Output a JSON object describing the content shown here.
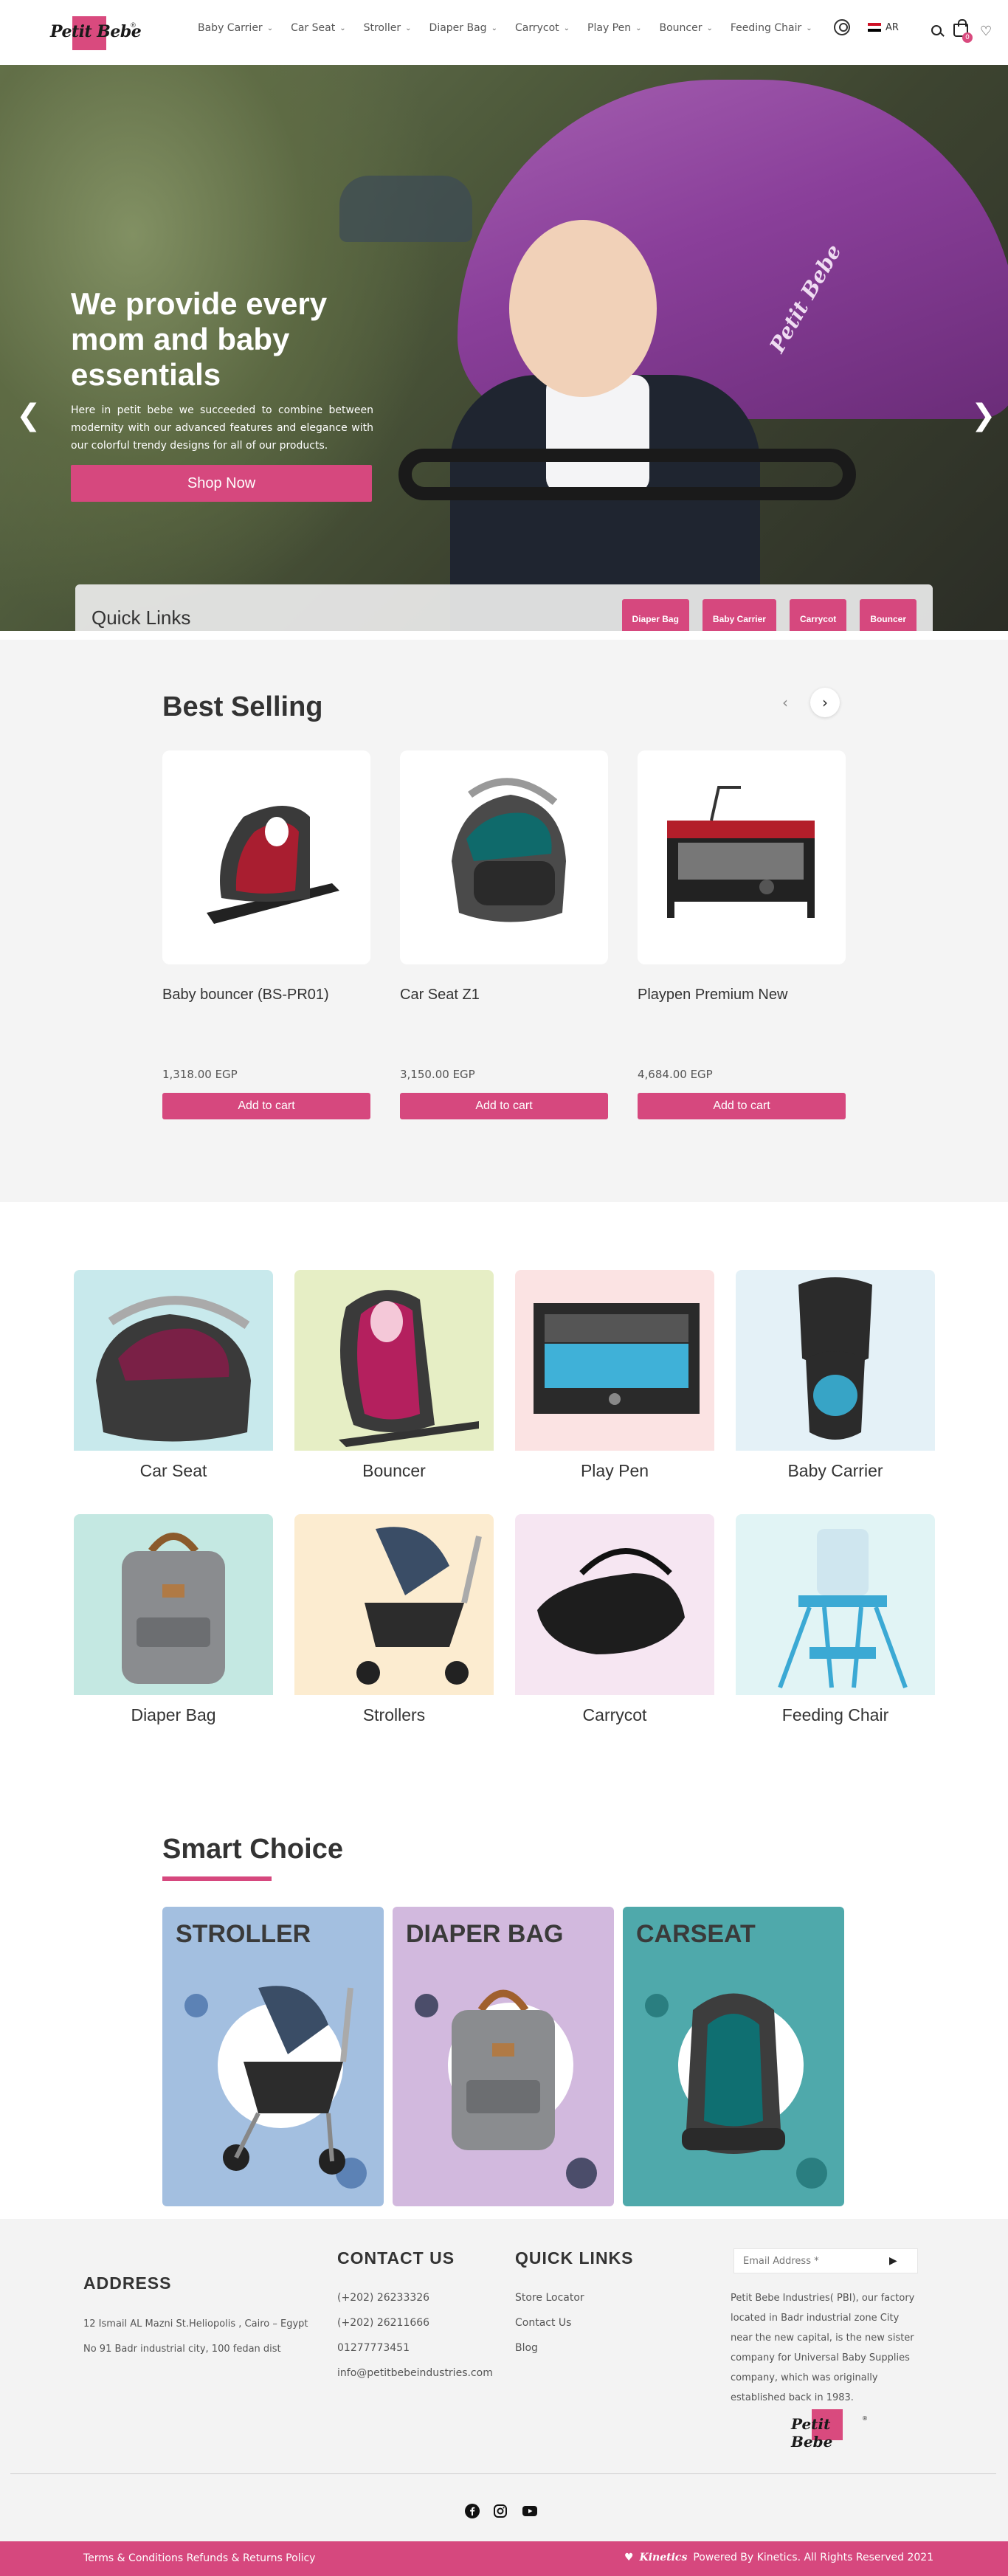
{
  "brand": {
    "logo_text": "Petit Bebe",
    "reg_mark": "®"
  },
  "header": {
    "nav": [
      {
        "label": "Baby Carrier"
      },
      {
        "label": "Car Seat"
      },
      {
        "label": "Stroller"
      },
      {
        "label": "Diaper Bag"
      },
      {
        "label": "Carrycot"
      },
      {
        "label": "Play Pen"
      },
      {
        "label": "Bouncer"
      },
      {
        "label": "Feeding Chair"
      }
    ],
    "lang_label": "AR",
    "cart_count": "0",
    "icons": [
      "user-icon",
      "flag-icon",
      "search-icon",
      "bag-icon",
      "heart-icon"
    ]
  },
  "hero": {
    "title": "We provide every mom and baby essentials",
    "description": "Here in petit bebe we succeeded to combine between modernity with our advanced features and elegance with our colorful trendy designs for all of our products.",
    "cta_label": "Shop Now",
    "canopy_text": "Petit Bebe",
    "prev_arrow": "❮",
    "next_arrow": "❯",
    "quick_links_title": "Quick Links",
    "quick_links": [
      {
        "label": "Diaper Bag"
      },
      {
        "label": "Baby Carrier"
      },
      {
        "label": "Carrycot"
      },
      {
        "label": "Bouncer"
      }
    ]
  },
  "best_selling": {
    "title": "Best Selling",
    "prev_arrow": "‹",
    "next_arrow": "›",
    "products": [
      {
        "name": "Baby bouncer (BS-PR01)",
        "price": "1,318.00 EGP",
        "button": "Add to cart"
      },
      {
        "name": "Car Seat Z1",
        "price": "3,150.00 EGP",
        "button": "Add to cart"
      },
      {
        "name": "Playpen Premium New",
        "price": "4,684.00 EGP",
        "button": "Add to cart"
      }
    ]
  },
  "categories": [
    {
      "label": "Car Seat",
      "bg": "#c8e9ec"
    },
    {
      "label": "Bouncer",
      "bg": "#e6eec5"
    },
    {
      "label": "Play Pen",
      "bg": "#fbe3e3"
    },
    {
      "label": "Baby Carrier",
      "bg": "#e4f1f7"
    },
    {
      "label": "Diaper Bag",
      "bg": "#c4e8e2"
    },
    {
      "label": "Strollers",
      "bg": "#fcecd0"
    },
    {
      "label": "Carrycot",
      "bg": "#f6e6f2"
    },
    {
      "label": "Feeding Chair",
      "bg": "#e1f4f5"
    }
  ],
  "smart_choice": {
    "title": "Smart Choice",
    "cards": [
      {
        "label": "STROLLER",
        "bg": "#a3bfe0",
        "dot": "#5c82b5"
      },
      {
        "label": "DIAPER BAG",
        "bg": "#d2b9de",
        "dot": "#4b4d6a"
      },
      {
        "label": "CARSEAT",
        "bg": "#4fa9ab",
        "dot": "#2a7e80"
      }
    ]
  },
  "footer": {
    "address_title": "ADDRESS",
    "address_lines": [
      "12 Ismail AL Mazni St.Heliopolis , Cairo – Egypt",
      "No 91 Badr industrial city, 100 fedan dist"
    ],
    "contact_title": "CONTACT US",
    "contact_lines": [
      "(+202) 26233326",
      "(+202) 26211666",
      "01277773451",
      "info@petitbebeindustries.com"
    ],
    "quick_links_title": "QUICK LINKS",
    "quick_links": [
      "Store Locator",
      "Contact Us",
      "Blog"
    ],
    "email_placeholder": "Email Address *",
    "send_icon": "▶",
    "about": "Petit Bebe Industries( PBI), our factory located in Badr industrial zone City near the new capital, is the new sister company for Universal Baby Supplies company, which was originally established back in 1983.",
    "social": [
      "facebook-icon",
      "instagram-icon",
      "youtube-icon"
    ],
    "bottom_left": "Terms & Conditions Refunds & Returns Policy",
    "bottom_brand": "Kinetics",
    "bottom_right": "Powered By Kinetics. All Rights Reserved 2021"
  },
  "colors": {
    "accent": "#d6487e"
  }
}
